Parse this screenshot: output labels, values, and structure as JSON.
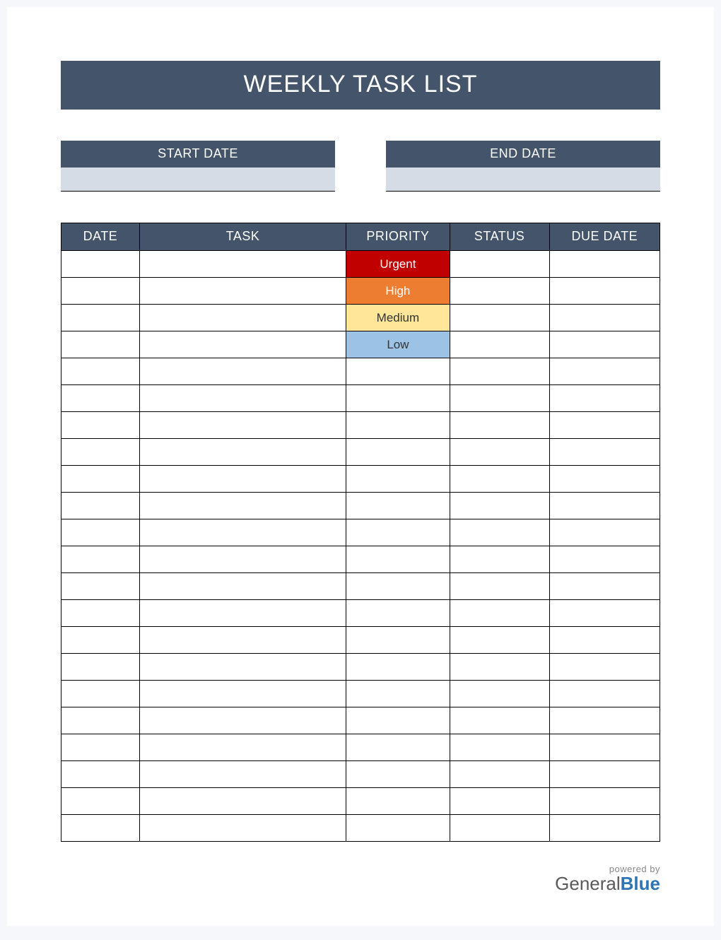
{
  "title": "WEEKLY TASK LIST",
  "dates": {
    "start_label": "START DATE",
    "start_value": "",
    "end_label": "END DATE",
    "end_value": ""
  },
  "columns": {
    "date": "DATE",
    "task": "TASK",
    "priority": "PRIORITY",
    "status": "STATUS",
    "due": "DUE DATE"
  },
  "priority_levels": [
    {
      "label": "Urgent",
      "class": "p-urgent"
    },
    {
      "label": "High",
      "class": "p-high"
    },
    {
      "label": "Medium",
      "class": "p-medium"
    },
    {
      "label": "Low",
      "class": "p-low"
    }
  ],
  "row_count": 22,
  "footer": {
    "powered": "powered by",
    "brand_a": "General",
    "brand_b": "Blue"
  }
}
